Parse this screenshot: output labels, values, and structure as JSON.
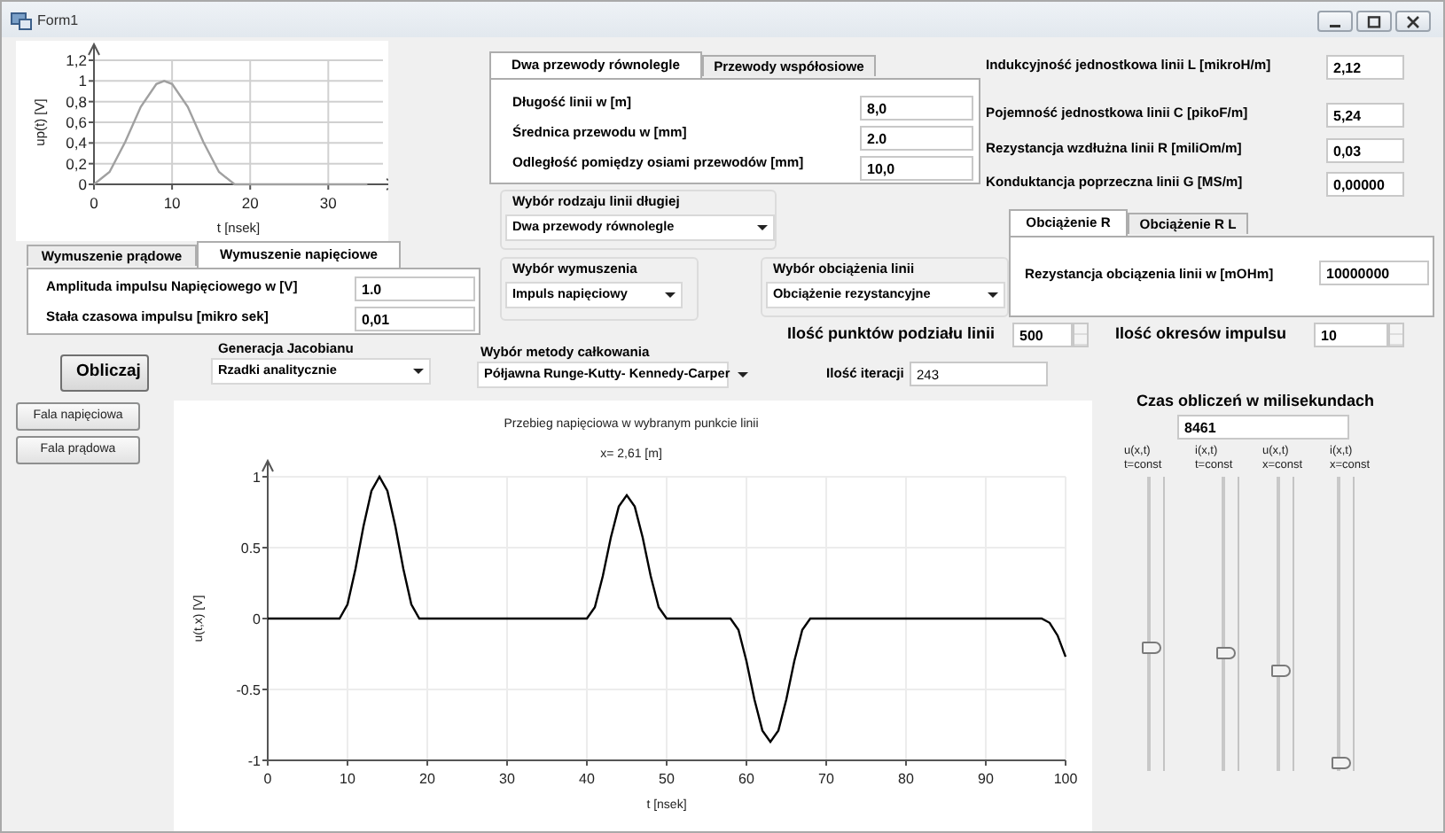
{
  "window": {
    "title": "Form1"
  },
  "pulse_chart": {
    "chart_data": {
      "type": "line",
      "xlabel": "t [nsek]",
      "ylabel": "up(t) [V]",
      "x": [
        0,
        2,
        4,
        6,
        8,
        9,
        10,
        12,
        14,
        16,
        18,
        20,
        25,
        30,
        35
      ],
      "grid": true,
      "series": [
        {
          "color": "#a0a0a0",
          "values": [
            0,
            0.12,
            0.41,
            0.75,
            0.97,
            1,
            0.97,
            0.75,
            0.41,
            0.12,
            0,
            0,
            0,
            0,
            0
          ]
        }
      ],
      "xlim": [
        0,
        37
      ],
      "ylim": [
        0,
        1.2
      ],
      "xticks": [
        0,
        10,
        20,
        30
      ],
      "yticks": [
        0,
        {
          "value": 0.2,
          "label": "0,2"
        },
        {
          "value": 0.4,
          "label": "0,4"
        },
        {
          "value": 0.6,
          "label": "0,6"
        },
        {
          "value": 0.8,
          "label": "0,8"
        },
        1,
        {
          "value": 1.2,
          "label": "1,2"
        }
      ]
    }
  },
  "excitation_tabs": {
    "tabs": [
      {
        "label": "Wymuszenie prądowe",
        "selected": false
      },
      {
        "label": "Wymuszenie napięciowe",
        "selected": true
      }
    ],
    "fields": [
      {
        "label": "Amplituda impulsu Napięciowego w [V]",
        "value": "1.0"
      },
      {
        "label": "Stała czasowa impulsu [mikro sek]",
        "value": "0,01"
      }
    ]
  },
  "line_tabs": {
    "tabs": [
      {
        "label": "Dwa przewody równolegle",
        "selected": true
      },
      {
        "label": "Przewody współosiowe",
        "selected": false
      }
    ],
    "fields": [
      {
        "label": "Długość linii w [m]",
        "value": "8,0"
      },
      {
        "label": "Średnica przewodu w [mm]",
        "value": "2.0"
      },
      {
        "label": "Odległość pomiędzy  osiami przewodów [mm]",
        "value": "10,0"
      }
    ]
  },
  "line_type": {
    "label": "Wybór rodzaju linii długiej",
    "value": "Dwa przewody równolegle"
  },
  "excitation": {
    "label": "Wybór wymuszenia",
    "value": "Impuls napięciowy"
  },
  "load": {
    "label": "Wybór obciążenia linii",
    "value": "Obciążenie rezystancyjne"
  },
  "line_parameters": [
    {
      "label": "Indukcyjność jednostkowa linii L [mikroH/m]",
      "value": "2,12"
    },
    {
      "label": "Pojemność jednostkowa linii C [pikoF/m]",
      "value": "5,24"
    },
    {
      "label": "Rezystancja wzdłużna linii R [miliOm/m]",
      "value": "0,03"
    },
    {
      "label": "Konduktancja poprzeczna  linii G [MS/m]",
      "value": "0,00000"
    }
  ],
  "load_tabs": {
    "tabs": [
      {
        "label": "Obciążenie R",
        "selected": true
      },
      {
        "label": "Obciążenie R L",
        "selected": false
      }
    ],
    "fields": [
      {
        "label": "Rezystancja obciązenia linii w [mOHm]",
        "value": "10000000"
      }
    ]
  },
  "division_points": {
    "label": "Ilość punktów podziału linii",
    "value": "500"
  },
  "pulse_periods": {
    "label": "Ilość okresów impulsu",
    "value": "10"
  },
  "jacobian": {
    "label": "Generacja Jacobianu",
    "value": "Rzadki analitycznie"
  },
  "integration_method": {
    "label": "Wybór metody całkowania",
    "value": "Półjawna Runge-Kutty- Kennedy-Carper"
  },
  "iterations": {
    "label": "Ilość iteracji",
    "value": "243"
  },
  "buttons": [
    {
      "label": "Obliczaj",
      "kind": "primary"
    },
    {
      "label": "Fala napięciowa",
      "kind": "plain"
    },
    {
      "label": "Fala prądowa",
      "kind": "plain"
    }
  ],
  "wave_chart": {
    "position": "x= 2,61 [m]",
    "chart_data": {
      "type": "line",
      "title": "Przebieg napięciowa w wybranym punkcie linii",
      "xlabel": "t [nsek]",
      "ylabel": "u(t,x) [V]",
      "x": [
        0,
        1,
        2,
        3,
        4,
        5,
        6,
        7,
        8,
        9,
        10,
        11,
        12,
        13,
        14,
        15,
        16,
        17,
        18,
        19,
        20,
        21,
        22,
        23,
        24,
        25,
        26,
        27,
        28,
        29,
        30,
        31,
        32,
        33,
        34,
        35,
        36,
        37,
        38,
        39,
        40,
        41,
        42,
        43,
        44,
        45,
        46,
        47,
        48,
        49,
        50,
        51,
        52,
        53,
        54,
        55,
        56,
        57,
        58,
        59,
        60,
        61,
        62,
        63,
        64,
        65,
        66,
        67,
        68,
        69,
        70,
        71,
        72,
        73,
        74,
        75,
        76,
        77,
        78,
        79,
        80,
        81,
        82,
        83,
        84,
        85,
        86,
        87,
        88,
        89,
        90,
        91,
        92,
        93,
        94,
        95,
        96,
        97,
        98,
        99,
        100
      ],
      "grid": true,
      "series": [
        {
          "color": "#000000",
          "values": [
            0,
            0,
            0,
            0,
            0,
            0,
            0,
            0,
            0,
            0,
            0.1,
            0.35,
            0.65,
            0.9,
            1,
            0.9,
            0.65,
            0.35,
            0.1,
            0,
            0,
            0,
            0,
            0,
            0,
            0,
            0,
            0,
            0,
            0,
            0,
            0,
            0,
            0,
            0,
            0,
            0,
            0,
            0,
            0,
            0,
            0.08,
            0.3,
            0.57,
            0.79,
            0.87,
            0.79,
            0.57,
            0.3,
            0.08,
            0,
            0,
            0,
            0,
            0,
            0,
            0,
            0,
            0,
            -0.08,
            -0.3,
            -0.57,
            -0.79,
            -0.87,
            -0.79,
            -0.57,
            -0.3,
            -0.08,
            0,
            0,
            0,
            0,
            0,
            0,
            0,
            0,
            0,
            0,
            0,
            0,
            0,
            0,
            0,
            0,
            0,
            0,
            0,
            0,
            0,
            0,
            0,
            0,
            0,
            0,
            0,
            0,
            0,
            0,
            -0.03,
            -0.12,
            -0.27
          ]
        }
      ],
      "xlim": [
        0,
        100
      ],
      "ylim": [
        -1,
        1
      ],
      "xticks": [
        0,
        10,
        20,
        30,
        40,
        50,
        60,
        70,
        80,
        90,
        100
      ],
      "yticks": [
        -1,
        -0.5,
        0,
        0.5,
        1
      ]
    }
  },
  "timing": {
    "label": "Czas obliczeń w milisekundach",
    "value": "8461"
  },
  "sliders": [
    {
      "function": "u(x,t)",
      "condition": "t=const",
      "level": 0.41
    },
    {
      "function": "i(x,t)",
      "condition": "t=const",
      "level": 0.39
    },
    {
      "function": "u(x,t)",
      "condition": "x=const",
      "level": 0.33
    },
    {
      "function": "i(x,t)",
      "condition": "x=const",
      "level": 0
    }
  ]
}
